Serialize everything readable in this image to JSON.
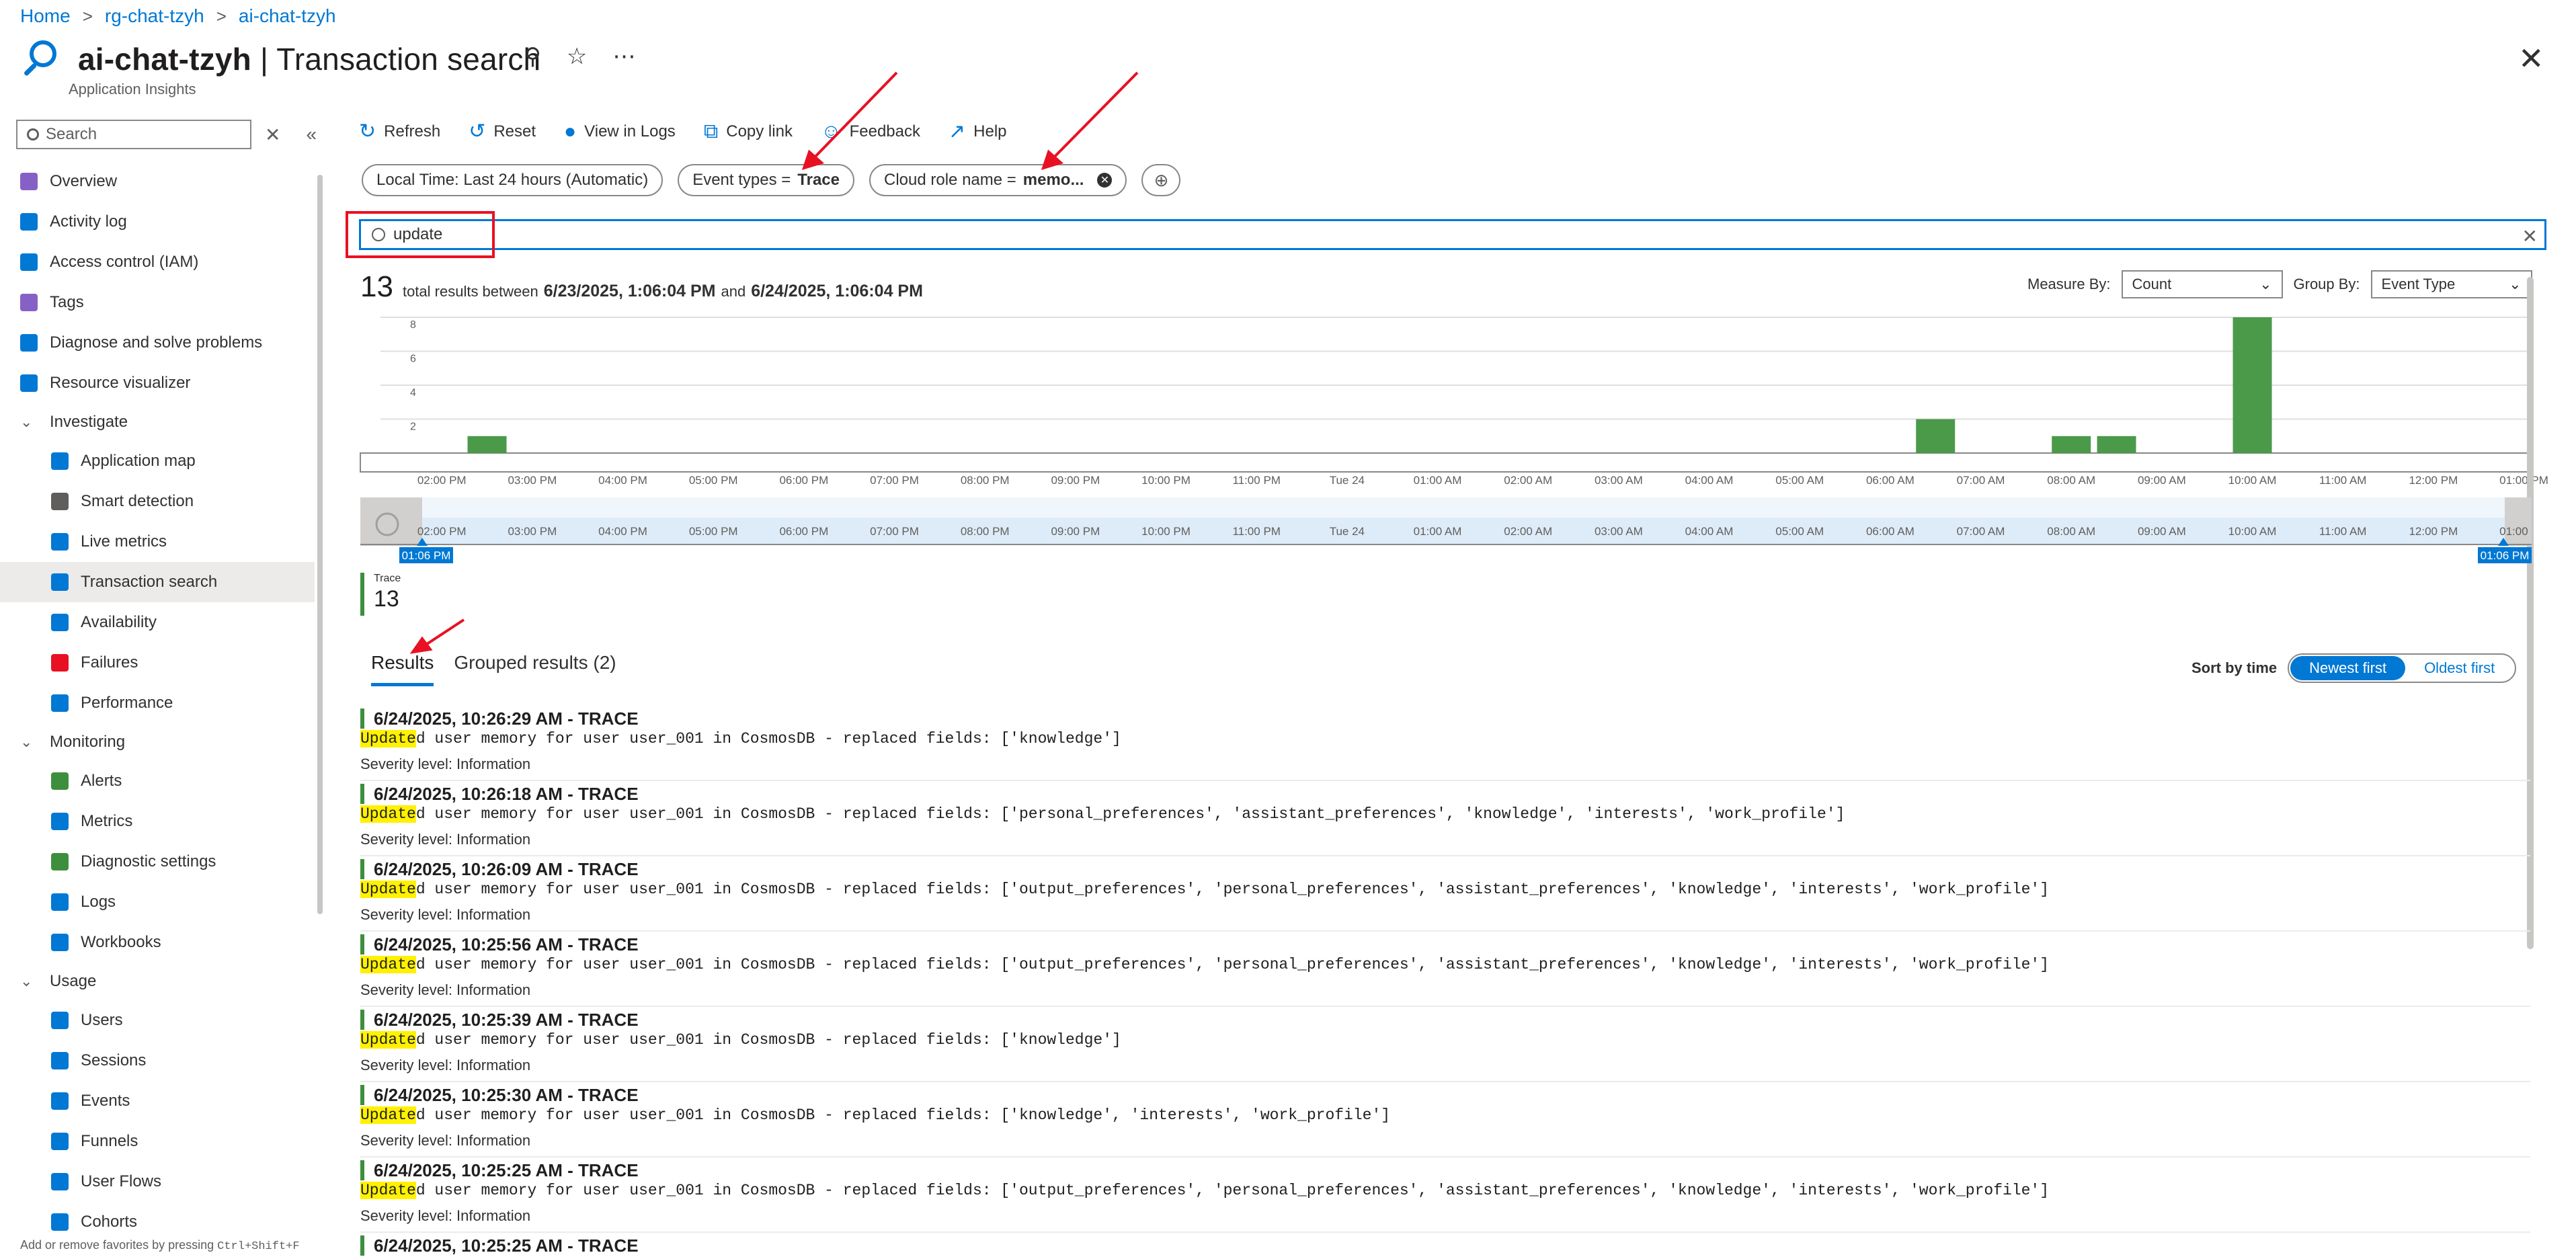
{
  "breadcrumb": [
    "Home",
    "rg-chat-tzyh",
    "ai-chat-tzyh"
  ],
  "title": {
    "resource": "ai-chat-tzyh",
    "separator": " | ",
    "page": "Transaction search",
    "subtitle": "Application Insights"
  },
  "sidebar": {
    "search_placeholder": "Search",
    "footer": {
      "text": "Add or remove favorites by pressing ",
      "shortcut": "Ctrl+Shift+F"
    },
    "items": [
      {
        "label": "Overview",
        "icon": "bulb-icon",
        "color": "#8661c5",
        "kind": "top"
      },
      {
        "label": "Activity log",
        "icon": "activity-log-icon",
        "color": "#0078d4",
        "kind": "top"
      },
      {
        "label": "Access control (IAM)",
        "icon": "people-icon",
        "color": "#0078d4",
        "kind": "top"
      },
      {
        "label": "Tags",
        "icon": "tag-icon",
        "color": "#8661c5",
        "kind": "top"
      },
      {
        "label": "Diagnose and solve problems",
        "icon": "wrench-icon",
        "color": "#0078d4",
        "kind": "top"
      },
      {
        "label": "Resource visualizer",
        "icon": "graph-icon",
        "color": "#0078d4",
        "kind": "top"
      },
      {
        "label": "Investigate",
        "kind": "section"
      },
      {
        "label": "Application map",
        "icon": "app-map-icon",
        "color": "#0078d4",
        "kind": "sub"
      },
      {
        "label": "Smart detection",
        "icon": "smart-detection-icon",
        "color": "#605e5c",
        "kind": "sub"
      },
      {
        "label": "Live metrics",
        "icon": "pulse-icon",
        "color": "#0078d4",
        "kind": "sub"
      },
      {
        "label": "Transaction search",
        "icon": "search-icon",
        "color": "#0078d4",
        "kind": "sub",
        "active": true
      },
      {
        "label": "Availability",
        "icon": "globe-icon",
        "color": "#0078d4",
        "kind": "sub"
      },
      {
        "label": "Failures",
        "icon": "failures-icon",
        "color": "#e81123",
        "kind": "sub"
      },
      {
        "label": "Performance",
        "icon": "performance-icon",
        "color": "#0078d4",
        "kind": "sub"
      },
      {
        "label": "Monitoring",
        "kind": "section"
      },
      {
        "label": "Alerts",
        "icon": "alert-icon",
        "color": "#3d8f3d",
        "kind": "sub"
      },
      {
        "label": "Metrics",
        "icon": "metrics-icon",
        "color": "#0078d4",
        "kind": "sub"
      },
      {
        "label": "Diagnostic settings",
        "icon": "diagnostic-icon",
        "color": "#3d8f3d",
        "kind": "sub"
      },
      {
        "label": "Logs",
        "icon": "logs-icon",
        "color": "#0078d4",
        "kind": "sub"
      },
      {
        "label": "Workbooks",
        "icon": "workbook-icon",
        "color": "#0078d4",
        "kind": "sub"
      },
      {
        "label": "Usage",
        "kind": "section"
      },
      {
        "label": "Users",
        "icon": "users-icon",
        "color": "#0078d4",
        "kind": "sub"
      },
      {
        "label": "Sessions",
        "icon": "sessions-icon",
        "color": "#0078d4",
        "kind": "sub"
      },
      {
        "label": "Events",
        "icon": "events-icon",
        "color": "#0078d4",
        "kind": "sub"
      },
      {
        "label": "Funnels",
        "icon": "funnel-icon",
        "color": "#0078d4",
        "kind": "sub"
      },
      {
        "label": "User Flows",
        "icon": "user-flows-icon",
        "color": "#0078d4",
        "kind": "sub"
      },
      {
        "label": "Cohorts",
        "icon": "cohorts-icon",
        "color": "#0078d4",
        "kind": "sub"
      }
    ]
  },
  "toolbar": [
    {
      "label": "Refresh",
      "icon": "refresh-icon",
      "glyph": "↻"
    },
    {
      "label": "Reset",
      "icon": "reset-icon",
      "glyph": "↺"
    },
    {
      "label": "View in Logs",
      "icon": "logs-icon",
      "glyph": "●"
    },
    {
      "label": "Copy link",
      "icon": "copy-icon",
      "glyph": "⧉"
    },
    {
      "label": "Feedback",
      "icon": "feedback-icon",
      "glyph": "☺"
    },
    {
      "label": "Help",
      "icon": "help-icon",
      "glyph": "↗"
    }
  ],
  "filters": {
    "time": "Local Time: Last 24 hours (Automatic)",
    "event_types": {
      "prefix": "Event types = ",
      "value": "Trace"
    },
    "cloud_role": {
      "prefix": "Cloud role name = ",
      "value": "memo..."
    }
  },
  "search": {
    "value": "update"
  },
  "summary": {
    "count": "13",
    "text": "total results between",
    "from": "6/23/2025, 1:06:04 PM",
    "and": "and",
    "to": "6/24/2025, 1:06:04 PM"
  },
  "measure_by": {
    "label": "Measure By:",
    "value": "Count"
  },
  "group_by": {
    "label": "Group By:",
    "value": "Event Type"
  },
  "chart_data": {
    "type": "bar",
    "ylim": [
      0,
      8
    ],
    "yticks": [
      0,
      2,
      4,
      6,
      8
    ],
    "xticks": [
      "02:00 PM",
      "03:00 PM",
      "04:00 PM",
      "05:00 PM",
      "06:00 PM",
      "07:00 PM",
      "08:00 PM",
      "09:00 PM",
      "10:00 PM",
      "11:00 PM",
      "Tue 24",
      "01:00 AM",
      "02:00 AM",
      "03:00 AM",
      "04:00 AM",
      "05:00 AM",
      "06:00 AM",
      "07:00 AM",
      "08:00 AM",
      "09:00 AM",
      "10:00 AM",
      "11:00 AM",
      "12:00 PM",
      "01:00 PM"
    ],
    "series": [
      {
        "name": "Trace",
        "color": "#4a9a4a",
        "points": [
          {
            "time": "6/23/2025 2:30 PM",
            "value": 1
          },
          {
            "time": "6/24/2025 6:30 AM",
            "value": 2
          },
          {
            "time": "6/24/2025 8:00 AM",
            "value": 1
          },
          {
            "time": "6/24/2025 8:30 AM",
            "value": 1
          },
          {
            "time": "6/24/2025 10:00 AM",
            "value": 8
          }
        ]
      }
    ],
    "brush": {
      "start_label": "01:06 PM",
      "end_label": "01:06 PM"
    }
  },
  "legend": {
    "label": "Trace",
    "count": "13"
  },
  "tabs": [
    "Results",
    "Grouped results (2)"
  ],
  "sort": {
    "label": "Sort by time",
    "options": [
      "Newest first",
      "Oldest first"
    ],
    "selected": "Newest first"
  },
  "results": [
    {
      "header": "6/24/2025, 10:26:29 AM - TRACE",
      "match": "Update",
      "rest": "d user memory for user user_001 in CosmosDB - replaced fields: ['knowledge']",
      "severity": "Severity level: Information"
    },
    {
      "header": "6/24/2025, 10:26:18 AM - TRACE",
      "match": "Update",
      "rest": "d user memory for user user_001 in CosmosDB - replaced fields: ['personal_preferences', 'assistant_preferences', 'knowledge', 'interests', 'work_profile']",
      "severity": "Severity level: Information"
    },
    {
      "header": "6/24/2025, 10:26:09 AM - TRACE",
      "match": "Update",
      "rest": "d user memory for user user_001 in CosmosDB - replaced fields: ['output_preferences', 'personal_preferences', 'assistant_preferences', 'knowledge', 'interests', 'work_profile']",
      "severity": "Severity level: Information"
    },
    {
      "header": "6/24/2025, 10:25:56 AM - TRACE",
      "match": "Update",
      "rest": "d user memory for user user_001 in CosmosDB - replaced fields: ['output_preferences', 'personal_preferences', 'assistant_preferences', 'knowledge', 'interests', 'work_profile']",
      "severity": "Severity level: Information"
    },
    {
      "header": "6/24/2025, 10:25:39 AM - TRACE",
      "match": "Update",
      "rest": "d user memory for user user_001 in CosmosDB - replaced fields: ['knowledge']",
      "severity": "Severity level: Information"
    },
    {
      "header": "6/24/2025, 10:25:30 AM - TRACE",
      "match": "Update",
      "rest": "d user memory for user user_001 in CosmosDB - replaced fields: ['knowledge', 'interests', 'work_profile']",
      "severity": "Severity level: Information"
    },
    {
      "header": "6/24/2025, 10:25:25 AM - TRACE",
      "match": "Update",
      "rest": "d user memory for user user_001 in CosmosDB - replaced fields: ['output_preferences', 'personal_preferences', 'assistant_preferences', 'knowledge', 'interests', 'work_profile']",
      "severity": "Severity level: Information"
    },
    {
      "header": "6/24/2025, 10:25:25 AM - TRACE",
      "match": "",
      "rest": "",
      "severity": ""
    }
  ]
}
